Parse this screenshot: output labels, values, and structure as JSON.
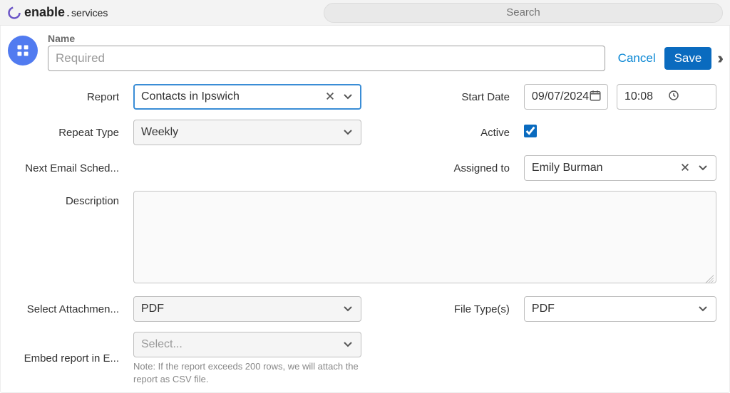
{
  "brand": {
    "bold": "enable",
    "dot": ".",
    "sub": "services"
  },
  "search": {
    "placeholder": "Search"
  },
  "header": {
    "name_label": "Name",
    "name_placeholder": "Required",
    "name_value": "",
    "cancel": "Cancel",
    "save": "Save"
  },
  "labels": {
    "report": "Report",
    "repeat_type": "Repeat Type",
    "next_email": "Next Email Sched...",
    "description": "Description",
    "select_attachment": "Select Attachmen...",
    "embed_report": "Embed report in E...",
    "start_date": "Start Date",
    "active": "Active",
    "assigned_to": "Assigned to",
    "file_types": "File Type(s)"
  },
  "fields": {
    "report": "Contacts in Ipswich",
    "repeat_type": "Weekly",
    "next_email": "",
    "description": "",
    "select_attachment": "PDF",
    "embed_report_placeholder": "Select...",
    "embed_note": "Note: If the report exceeds 200 rows, we will attach the report as CSV file.",
    "start_date": "09/07/2024",
    "start_time": "10:08",
    "active": true,
    "assigned_to": "Emily Burman",
    "file_types": "PDF"
  }
}
